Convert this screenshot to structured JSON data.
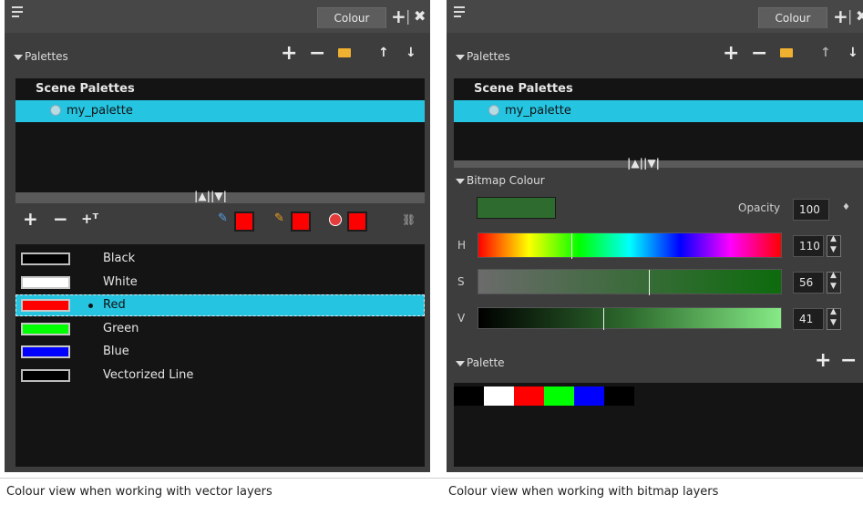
{
  "left_panel": {
    "tab_label": "Colour",
    "palettes_header": "Palettes",
    "palette_list": {
      "group": "Scene Palettes",
      "selected": "my_palette"
    },
    "swatch_colours": [
      "#ff0000",
      "#ff0000",
      "#ff0000"
    ],
    "colours": [
      {
        "name": "Black",
        "color": "#000000",
        "selected": false
      },
      {
        "name": "White",
        "color": "#ffffff",
        "selected": false
      },
      {
        "name": "Red",
        "color": "#ff0000",
        "selected": true
      },
      {
        "name": "Green",
        "color": "#00ff00",
        "selected": false
      },
      {
        "name": "Blue",
        "color": "#0000ff",
        "selected": false
      },
      {
        "name": "Vectorized Line",
        "color": "#000000",
        "selected": false
      }
    ]
  },
  "right_panel": {
    "tab_label": "Colour",
    "palettes_header": "Palettes",
    "palette_list": {
      "group": "Scene Palettes",
      "selected": "my_palette"
    },
    "bitmap_colour_header": "Bitmap Colour",
    "current_colour": "#2e6b2e",
    "opacity_label": "Opacity",
    "opacity_value": "100",
    "sliders": [
      {
        "label": "H",
        "value": "110",
        "level_fraction": 0.306
      },
      {
        "label": "S",
        "value": "56",
        "level_fraction": 0.56
      },
      {
        "label": "V",
        "value": "41",
        "level_fraction": 0.41
      }
    ],
    "palette_header": "Palette",
    "palette_strip": [
      "#000000",
      "#ffffff",
      "#ff0000",
      "#00ff00",
      "#0000ff",
      "#000000"
    ]
  },
  "captions": {
    "left": "Colour view when working with vector layers",
    "right": "Colour view when working with bitmap layers"
  },
  "colors": {
    "accent": "#25c5e2",
    "panel_bg": "#3d3d3d",
    "list_bg": "#141414"
  }
}
